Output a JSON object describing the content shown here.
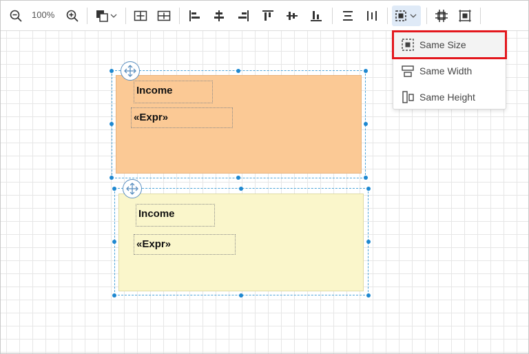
{
  "toolbar": {
    "zoom_level": "100%",
    "buttons": [
      "zoom-out-icon",
      "zoom-in-icon",
      "fill-color-icon",
      "center-horizontally-icon",
      "center-vertically-icon",
      "align-left-icon",
      "align-center-icon",
      "align-right-icon",
      "align-top-icon",
      "align-middle-icon",
      "align-bottom-icon",
      "distribute-horizontally-icon",
      "distribute-vertically-icon",
      "make-same-size-icon",
      "fit-to-band-icon",
      "size-to-grid-icon"
    ]
  },
  "menu": {
    "items": [
      {
        "label": "Same Size",
        "icon": "same-size-icon"
      },
      {
        "label": "Same Width",
        "icon": "same-width-icon"
      },
      {
        "label": "Same Height",
        "icon": "same-height-icon"
      }
    ]
  },
  "bands": [
    {
      "color": "#fbc995",
      "fields": [
        "Income",
        "«Expr»"
      ]
    },
    {
      "color": "#faf6cb",
      "fields": [
        "Income",
        "«Expr»"
      ]
    }
  ],
  "colors": {
    "accent": "#1e88d0",
    "highlight": "#e3161c"
  }
}
